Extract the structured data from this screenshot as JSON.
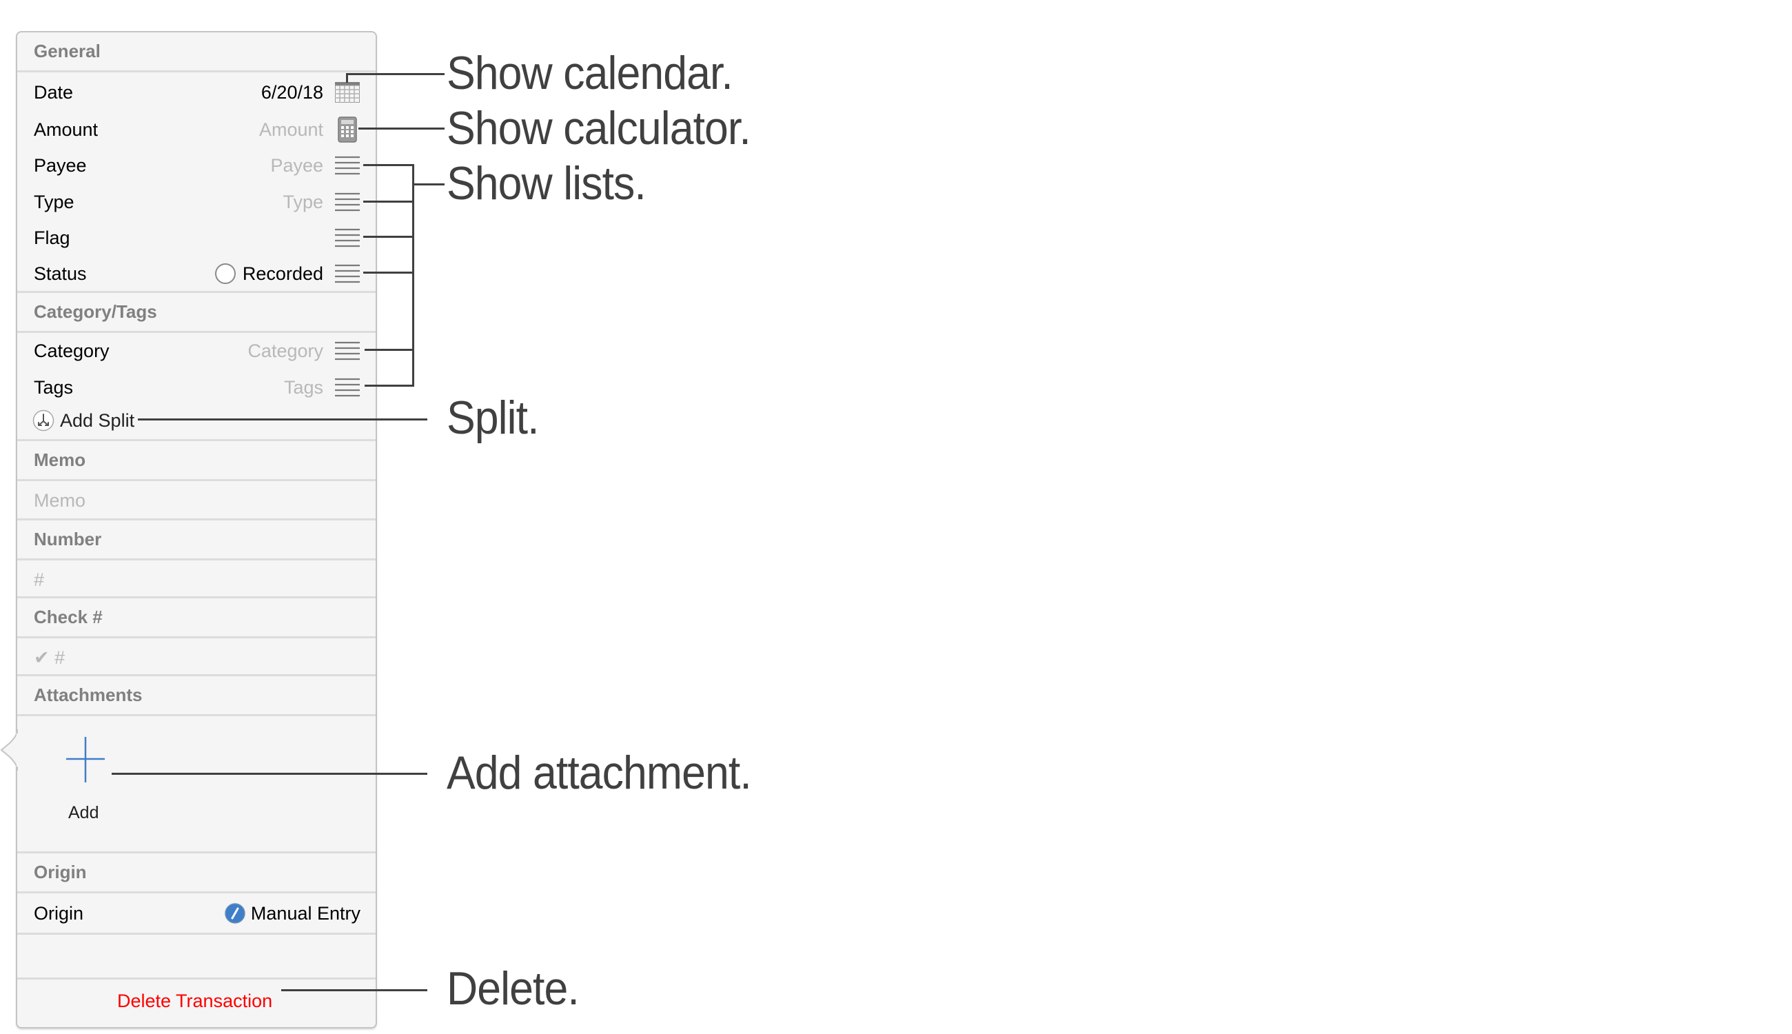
{
  "panel": {
    "sections": {
      "general": "General",
      "category_tags": "Category/Tags",
      "memo": "Memo",
      "number": "Number",
      "check": "Check #",
      "attachments": "Attachments",
      "origin": "Origin"
    },
    "rows": {
      "date": {
        "label": "Date",
        "value": "6/20/18",
        "icon": "calendar-icon"
      },
      "amount": {
        "label": "Amount",
        "placeholder": "Amount",
        "icon": "calculator-icon"
      },
      "payee": {
        "label": "Payee",
        "placeholder": "Payee",
        "icon": "list-icon"
      },
      "type": {
        "label": "Type",
        "placeholder": "Type",
        "icon": "list-icon"
      },
      "flag": {
        "label": "Flag",
        "icon": "list-icon"
      },
      "status": {
        "label": "Status",
        "value": "Recorded",
        "icon": "list-icon"
      },
      "category": {
        "label": "Category",
        "placeholder": "Category",
        "icon": "list-icon"
      },
      "tags": {
        "label": "Tags",
        "placeholder": "Tags",
        "icon": "list-icon"
      },
      "origin": {
        "label": "Origin",
        "value": "Manual Entry",
        "icon": "pencil-icon"
      }
    },
    "add_split": "Add Split",
    "memo_placeholder": "Memo",
    "number_placeholder": "#",
    "check_placeholder": "✔ #",
    "add_attachment_label": "Add",
    "delete_label": "Delete Transaction"
  },
  "callouts": {
    "calendar": "Show calendar.",
    "calculator": "Show calculator.",
    "lists": "Show lists.",
    "split": "Split.",
    "attachment": "Add attachment.",
    "delete": "Delete."
  },
  "colors": {
    "accent": "#3f7ec8",
    "delete": "#ff0000",
    "callout_text": "#404040"
  }
}
